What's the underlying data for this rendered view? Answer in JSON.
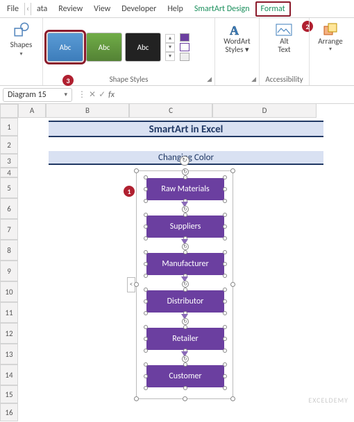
{
  "tabs": {
    "file": "File",
    "data": "ata",
    "review": "Review",
    "view": "View",
    "developer": "Developer",
    "help": "Help",
    "smartart": "SmartArt Design",
    "format": "Format"
  },
  "ribbon": {
    "shapes_label": "Shapes",
    "style_thumb_text": "Abc",
    "shape_styles_label": "Shape Styles",
    "wordart_label": "WordArt",
    "wordart_sub": "Styles",
    "alttext_l1": "Alt",
    "alttext_l2": "Text",
    "accessibility_label": "Accessibility",
    "arrange_label": "Arrange"
  },
  "badges": {
    "b1": "1",
    "b2": "2",
    "b3": "3"
  },
  "namebox": "Diagram 15",
  "fx": "fx",
  "columns": {
    "A": "A",
    "B": "B",
    "C": "C",
    "D": "D"
  },
  "rows": [
    "1",
    "2",
    "3",
    "4",
    "5",
    "6",
    "7",
    "8",
    "9",
    "10",
    "11",
    "12",
    "13",
    "14",
    "15",
    "16"
  ],
  "sheet": {
    "title": "SmartArt in Excel",
    "subtitle": "Changing Color"
  },
  "smartart": {
    "items": [
      "Raw Materials",
      "Suppliers",
      "Manufacturer",
      "Distributor",
      "Retailer",
      "Customer"
    ]
  },
  "pane_btn": "<",
  "rotate_glyph": "↻",
  "watermark": "EXCELDEMY"
}
